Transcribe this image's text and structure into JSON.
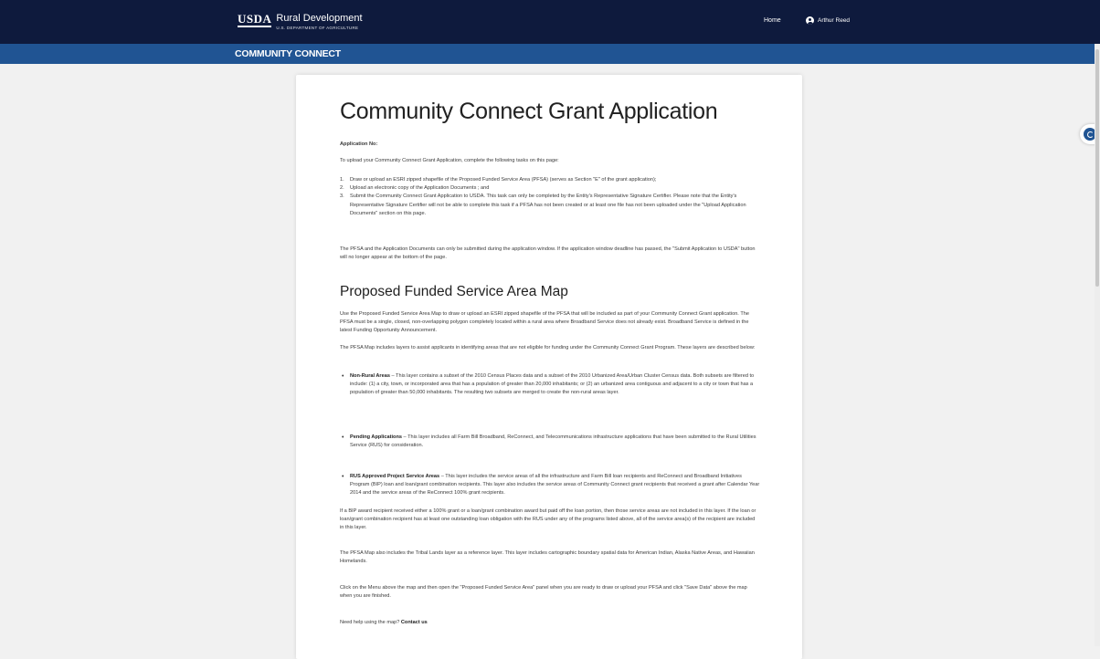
{
  "header": {
    "logo_agency": "USDA",
    "logo_title": "Rural Development",
    "logo_subtitle": "U.S. DEPARTMENT OF AGRICULTURE",
    "nav_home": "Home",
    "user_name": "Arthur Reed"
  },
  "subheader": {
    "title": "COMMUNITY CONNECT"
  },
  "page": {
    "title": "Community Connect Grant Application",
    "application_no_label": "Application No:",
    "intro": "To upload your Community Connect Grant Application, complete the following tasks on this page:",
    "tasks": [
      {
        "num": "1.",
        "text": "Draw or upload an ESRI zipped shapefile of the Proposed Funded Service Area (PFSA) (serves as Section \"E\" of the grant application);"
      },
      {
        "num": "2.",
        "text": "Upload an electronic copy of the Application Documents ; and"
      },
      {
        "num": "3.",
        "text": "Submit the Community Connect Grant Application to USDA. This task can only be completed by the Entity's Representative Signature Certifier. Please note that the Entity's Representative Signature Certifier will not be able to complete this task if a PFSA has not been created or at least one file has not been uploaded under the \"Upload Application Documents\" section on this page."
      }
    ],
    "window_note": "The PFSA and the Application Documents can only be submitted during the application window. If the application window deadline has passed, the \"Submit Application to USDA\" button will no longer appear at the bottom of the page.",
    "map_heading": "Proposed Funded Service Area Map",
    "map_intro": "Use the Proposed Funded Service Area Map to draw or upload an ESRI zipped shapefile of the PFSA that will be included as part of your Community Connect Grant application. The PFSA must be a single, closed, non-overlapping polygon completely located within a rural area where Broadband Service does not already exist. Broadband Service is defined in the latest Funding Opportunity Announcement.",
    "map_layers_intro": "The PFSA Map includes layers to assist applicants in identifying areas that are not eligible for funding under the Community Connect Grant Program. These layers are described below:",
    "layers": [
      {
        "term": "Non-Rural Areas",
        "text": " – This layer contains a subset of the 2010 Census Places data and a subset of the 2010 Urbanized Area/Urban Cluster Census data. Both subsets are filtered to include: (1) a city, town, or incorporated area that has a population of greater than 20,000 inhabitants; or (2) an urbanized area contiguous and adjacent to a city or town that has a population of greater than 50,000 inhabitants. The resulting two subsets are merged to create the non-rural areas layer."
      },
      {
        "term": "Pending Applications",
        "text": " – This layer includes all Farm Bill Broadband, ReConnect, and Telecommunications infrastructure applications that have been submitted to the Rural Utilities Service (RUS) for consideration."
      },
      {
        "term": "RUS Approved Project Service Areas",
        "text": " – This layer includes the service areas of all the infrastructure and Farm Bill loan recipients and ReConnect and Broadband Initiatives Program (BIP) loan and loan/grant combination recipients. This layer also includes the service areas of Community Connect grant recipients that received a grant after Calendar Year 2014 and the service areas of the ReConnect 100% grant recipients."
      }
    ],
    "bip_note": "If a BIP award recipient received either a 100% grant or a loan/grant combination award but paid off the loan portion, then those service areas are not included in this layer. If the loan or loan/grant combination recipient has at least one outstanding loan obligation with the RUS under any of the programs listed above, all of the service area(s) of the recipient are included in this layer.",
    "tribal_note": "The PFSA Map also includes the Tribal Lands layer as a reference layer. This layer includes cartographic boundary spatial data for American Indian, Alaska Native Areas, and Hawaiian Homelands.",
    "menu_note": "Click on the Menu above the map and then open the \"Proposed Funded Service Area\" panel when you are ready to draw or upload your PFSA and click \"Save Data\" above the map when you are finished.",
    "help_text": "Need help using the map?",
    "contact_link": "Contact us"
  }
}
